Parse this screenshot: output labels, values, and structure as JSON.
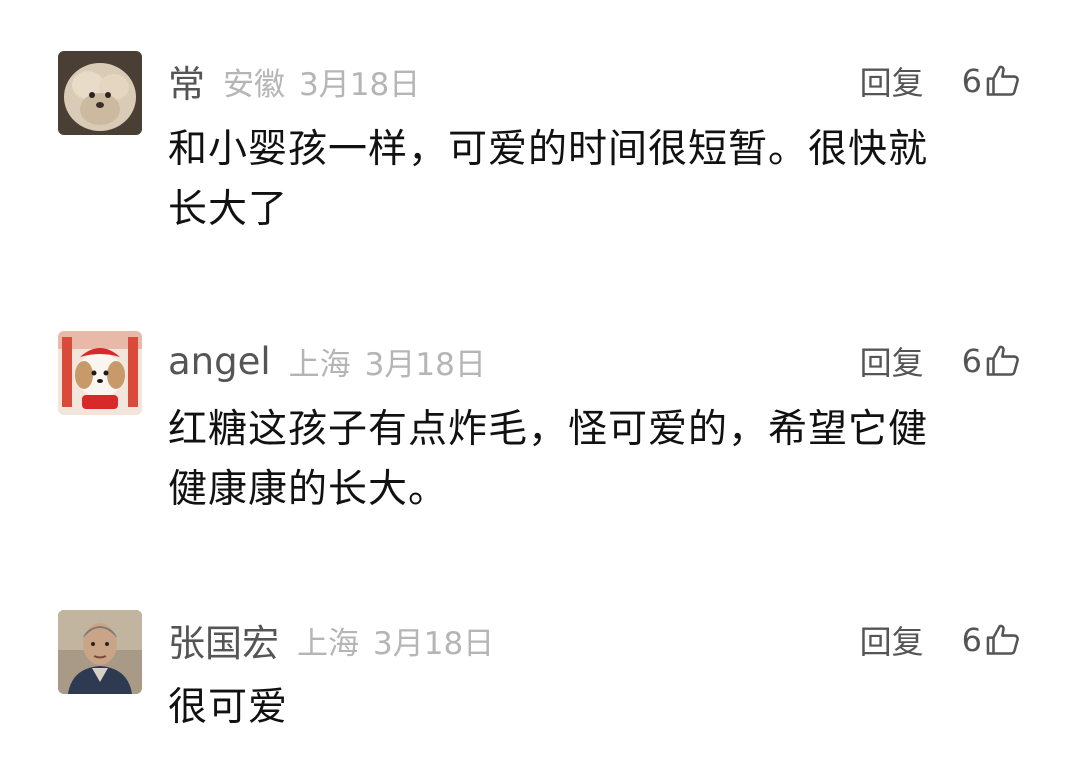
{
  "comments": [
    {
      "username": "常",
      "location": "安徽",
      "date": "3月18日",
      "reply_label": "回复",
      "like_count": "6",
      "text_lines": [
        "和小婴孩一样，可爱的时间很短暂。很快就",
        "长大了"
      ]
    },
    {
      "username": "angel",
      "location": "上海",
      "date": "3月18日",
      "reply_label": "回复",
      "like_count": "6",
      "text_lines": [
        "红糖这孩子有点炸毛，怪可爱的，希望它健",
        "健康康的长大。"
      ]
    },
    {
      "username": "张国宏",
      "location": "上海",
      "date": "3月18日",
      "reply_label": "回复",
      "like_count": "6",
      "text_lines": [
        "很可爱"
      ]
    }
  ],
  "colors": {
    "username": "#555555",
    "meta": "#b5b5b5",
    "body_text": "#111111",
    "background": "#ffffff"
  },
  "icons": {
    "like": "thumbs-up-icon",
    "avatar_1": "fluffy-pet-photo",
    "avatar_2": "dog-in-red-costume-photo",
    "avatar_3": "older-man-portrait-photo"
  }
}
